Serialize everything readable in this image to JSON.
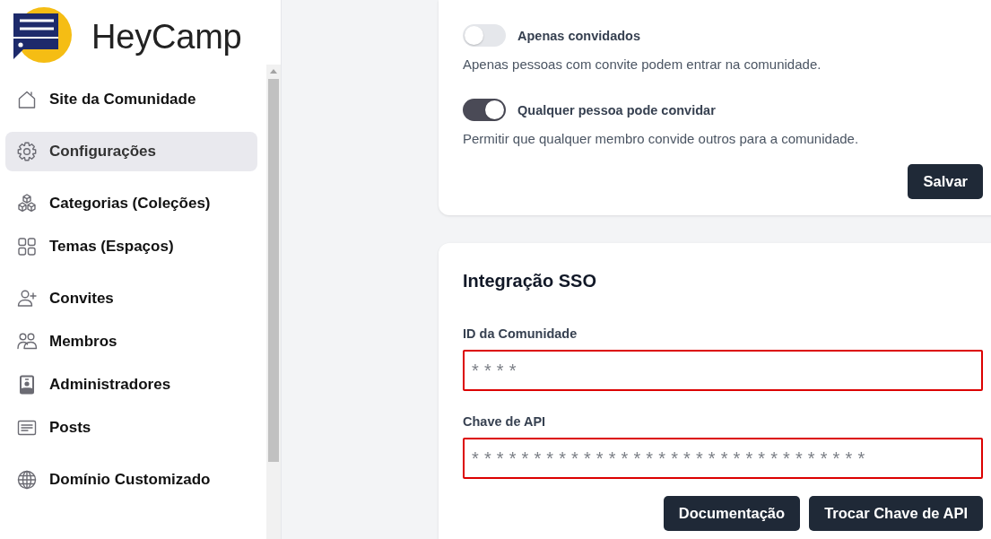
{
  "sidebar": {
    "brand": "HeyCamp",
    "sections": [
      {
        "items": [
          {
            "label": "Site da Comunidade",
            "selected": false
          }
        ]
      },
      {
        "items": [
          {
            "label": "Configurações",
            "selected": true
          }
        ]
      },
      {
        "items": [
          {
            "label": "Categorias (Coleções)",
            "selected": false
          },
          {
            "label": "Temas (Espaços)",
            "selected": false
          }
        ]
      },
      {
        "items": [
          {
            "label": "Convites",
            "selected": false
          },
          {
            "label": "Membros",
            "selected": false
          },
          {
            "label": "Administradores",
            "selected": false
          },
          {
            "label": "Posts",
            "selected": false
          }
        ]
      },
      {
        "items": [
          {
            "label": "Domínio Customizado",
            "selected": false
          }
        ]
      }
    ]
  },
  "access_card": {
    "toggles": [
      {
        "label": "Apenas convidados",
        "on": false,
        "description": "Apenas pessoas com convite podem entrar na comunidade."
      },
      {
        "label": "Qualquer pessoa pode convidar",
        "on": true,
        "description": "Permitir que qualquer membro convide outros para a comunidade."
      }
    ],
    "buttons": [
      "Salvar"
    ]
  },
  "sso_card": {
    "title": "Integração SSO",
    "fields": [
      {
        "label": "ID da Comunidade",
        "placeholder": "****",
        "error": true
      },
      {
        "label": "Chave de API",
        "placeholder": "********************************",
        "error": true
      }
    ],
    "buttons": [
      "Documentação",
      "Trocar Chave de API"
    ]
  }
}
